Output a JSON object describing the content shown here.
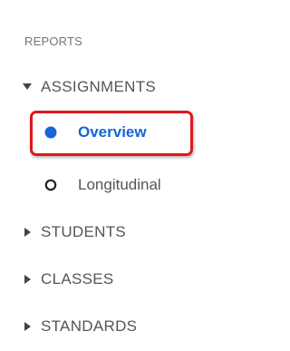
{
  "section": {
    "title": "REPORTS"
  },
  "groups": [
    {
      "label": "ASSIGNMENTS",
      "expanded": true,
      "items": [
        {
          "label": "Overview",
          "selected": true
        },
        {
          "label": "Longitudinal",
          "selected": false
        }
      ]
    },
    {
      "label": "STUDENTS",
      "expanded": false
    },
    {
      "label": "CLASSES",
      "expanded": false
    },
    {
      "label": "STANDARDS",
      "expanded": false
    }
  ],
  "colors": {
    "accent_blue": "#1565d8",
    "highlight_red": "#e0161d",
    "text_gray": "#555555",
    "section_gray": "#767676"
  },
  "icons": {
    "expanded": "caret-down-icon",
    "collapsed": "caret-right-icon",
    "selected": "radio-filled-icon",
    "unselected": "radio-empty-icon"
  }
}
